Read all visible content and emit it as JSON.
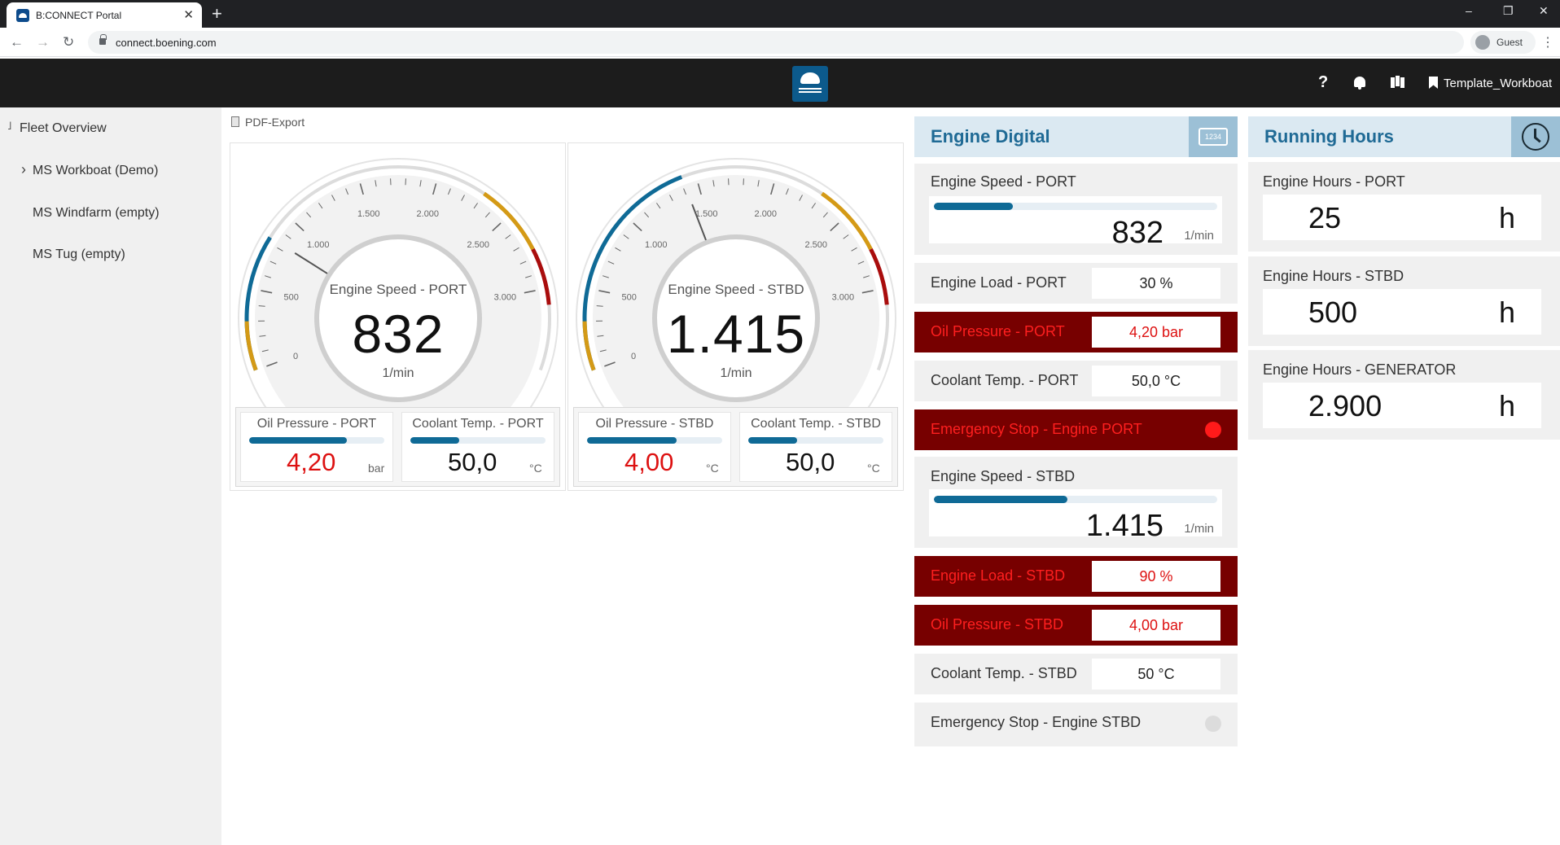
{
  "browser": {
    "tab_title": "B:CONNECT Portal",
    "tab_close": "✕",
    "new_tab": "+",
    "url": "connect.boening.com",
    "profile": "Guest",
    "win_minimize": "–",
    "win_restore": "❐",
    "win_close": "✕",
    "nav_back": "←",
    "nav_forward": "→",
    "nav_reload": "↻",
    "kebab": "⋮"
  },
  "header": {
    "help": "?",
    "template": "Template_Workboat"
  },
  "sidebar": {
    "fleet_overview": {
      "marker": "˩",
      "label": "Fleet Overview"
    },
    "items": [
      {
        "marker": "›",
        "label": "MS Workboat (Demo)"
      },
      {
        "marker": "",
        "label": "MS Windfarm (empty)"
      },
      {
        "marker": "",
        "label": "MS Tug (empty)"
      }
    ]
  },
  "main": {
    "pdf_export": "PDF-Export",
    "gauges": [
      {
        "title": "Engine Speed - PORT",
        "value": "832",
        "value_num": 832,
        "unit": "1/min",
        "ticks": [
          "0",
          "500",
          "1.000",
          "1.500",
          "2.000",
          "2.500",
          "3.000"
        ],
        "sub": [
          {
            "title": "Oil Pressure - PORT",
            "value": "4,20",
            "unit": "bar",
            "alarm": true,
            "fill": 0.72
          },
          {
            "title": "Coolant Temp. - PORT",
            "value": "50,0",
            "unit": "°C",
            "alarm": false,
            "fill": 0.36
          }
        ]
      },
      {
        "title": "Engine Speed - STBD",
        "value": "1.415",
        "value_num": 1415,
        "unit": "1/min",
        "ticks": [
          "0",
          "500",
          "1.000",
          "1.500",
          "2.000",
          "2.500",
          "3.000"
        ],
        "sub": [
          {
            "title": "Oil Pressure - STBD",
            "value": "4,00",
            "unit": "°C",
            "alarm": true,
            "fill": 0.66
          },
          {
            "title": "Coolant Temp. - STBD",
            "value": "50,0",
            "unit": "°C",
            "alarm": false,
            "fill": 0.36
          }
        ]
      }
    ]
  },
  "engine_digital": {
    "title": "Engine Digital",
    "icon_text": "1234",
    "speed_port": {
      "label": "Engine Speed - PORT",
      "value": "832",
      "unit": "1/min",
      "fill": 0.28
    },
    "load_port": {
      "label": "Engine Load - PORT",
      "value": "30 %",
      "alarm": false
    },
    "oil_port": {
      "label": "Oil Pressure - PORT",
      "value": "4,20 bar",
      "alarm": true
    },
    "coolant_port": {
      "label": "Coolant Temp. - PORT",
      "value": "50,0 °C",
      "alarm": false
    },
    "estop_port": {
      "label": "Emergency Stop - Engine PORT",
      "active": true
    },
    "speed_stbd": {
      "label": "Engine Speed - STBD",
      "value": "1.415",
      "unit": "1/min",
      "fill": 0.47
    },
    "load_stbd": {
      "label": "Engine Load - STBD",
      "value": "90 %",
      "alarm": true
    },
    "oil_stbd": {
      "label": "Oil Pressure - STBD",
      "value": "4,00 bar",
      "alarm": true
    },
    "coolant_stbd": {
      "label": "Coolant Temp. - STBD",
      "value": "50 °C",
      "alarm": false
    },
    "estop_stbd": {
      "label": "Emergency Stop - Engine STBD",
      "active": false
    }
  },
  "running_hours": {
    "title": "Running Hours",
    "rows": [
      {
        "label": "Engine Hours - PORT",
        "value": "25",
        "unit": "h"
      },
      {
        "label": "Engine Hours - STBD",
        "value": "500",
        "unit": "h"
      },
      {
        "label": "Engine Hours - GENERATOR",
        "value": "2.900",
        "unit": "h"
      }
    ]
  },
  "colors": {
    "accent": "#0f6a96",
    "alarm_bg": "#770000",
    "alarm_text": "#ff1f1f",
    "estop_active": "#ff1a1a",
    "estop_inactive": "#dcdcdc",
    "warn_arc": "#d49a16",
    "danger_arc": "#a90d0d"
  }
}
